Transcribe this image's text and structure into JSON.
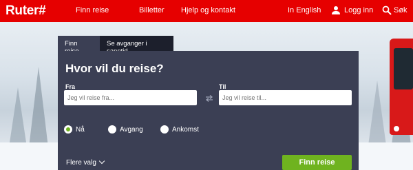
{
  "header": {
    "logo": "Ruter#",
    "nav": [
      "Finn reise",
      "Billetter",
      "Hjelp og kontakt"
    ],
    "language": "In English",
    "login": "Logg inn",
    "search": "Søk",
    "brand_color": "#e60000"
  },
  "planner": {
    "tabs": [
      "Finn reise",
      "Se avganger i sanntid"
    ],
    "active_tab": "Finn reise",
    "title": "Hvor vil du reise?",
    "from_label": "Fra",
    "from_placeholder": "Jeg vil reise fra...",
    "to_label": "Til",
    "to_placeholder": "Jeg vil reise til...",
    "time_options": [
      "Nå",
      "Avgang",
      "Ankomst"
    ],
    "selected_time": "Nå",
    "more_options": "Flere valg",
    "submit": "Finn reise",
    "accent": "#6fb31f",
    "panel_color": "#3b3f54"
  }
}
